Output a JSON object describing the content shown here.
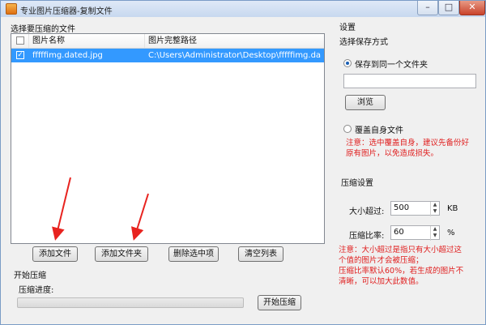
{
  "window": {
    "title": "专业图片压缩器-复制文件"
  },
  "file_list": {
    "section_label": "选择要压缩的文件",
    "columns": [
      "图片名称",
      "图片完整路径"
    ],
    "rows": [
      {
        "name": "fffffimg.dated.jpg",
        "path": "C:\\Users\\Administrator\\Desktop\\fffffimg.da..."
      }
    ]
  },
  "buttons": {
    "add_file": "添加文件",
    "add_folder": "添加文件夹",
    "delete_selected": "删除选中项",
    "clear_list": "清空列表",
    "start": "开始压缩",
    "browse": "浏览"
  },
  "compress": {
    "section_label": "开始压缩",
    "progress_label": "压缩进度:",
    "progress": 0.0
  },
  "settings": {
    "title": "设置",
    "save_mode_label": "选择保存方式",
    "save_same_folder": "保存到同一个文件夹",
    "folder_path": "",
    "overwrite": "覆盖自身文件",
    "overwrite_note_1": "注意：选中覆盖自身，建议先备份好",
    "overwrite_note_2": "原有图片，以免造成损失。",
    "compress_settings": "压缩设置",
    "size_label": "大小超过:",
    "size_value": "500",
    "size_unit": "KB",
    "ratio_label": "压缩比率:",
    "ratio_value": "60",
    "ratio_unit": "%",
    "notes": [
      "注意：大小超过是指只有大小超过这",
      "个值的图片才会被压缩；",
      "压缩比率默认60%，若生成的图片不",
      "清晰，可以加大此数值。"
    ]
  },
  "colors": {
    "accent": "#3399ff",
    "warning": "#e02020",
    "arrow": "#e8231f"
  }
}
